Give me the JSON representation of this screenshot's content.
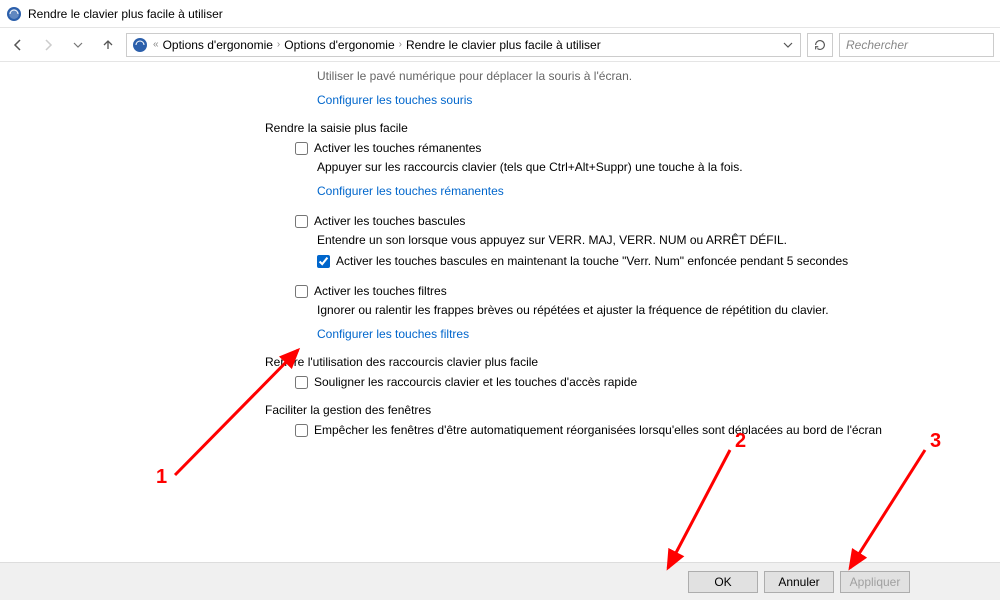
{
  "titlebar": {
    "title": "Rendre le clavier plus facile à utiliser"
  },
  "nav": {
    "breadcrumb": {
      "prefix": "«",
      "items": [
        "Options d'ergonomie",
        "Options d'ergonomie",
        "Rendre le clavier plus facile à utiliser"
      ]
    },
    "search_placeholder": "Rechercher"
  },
  "content": {
    "truncated_line": "Utiliser le pavé numérique pour déplacer la souris à l'écran.",
    "link_mouse": "Configurer les touches souris",
    "sec1": {
      "title": "Rendre la saisie plus facile",
      "sticky": {
        "label": "Activer les touches rémanentes",
        "desc": "Appuyer sur les raccourcis clavier (tels que Ctrl+Alt+Suppr) une touche à la fois.",
        "link": "Configurer les touches rémanentes"
      },
      "toggle": {
        "label": "Activer les touches bascules",
        "desc": "Entendre un son lorsque vous appuyez sur VERR. MAJ, VERR. NUM ou ARRÊT DÉFIL.",
        "sub_label": "Activer les touches bascules en maintenant la touche \"Verr. Num\" enfoncée pendant 5 secondes"
      },
      "filter": {
        "label": "Activer les touches filtres",
        "desc": "Ignorer ou ralentir les frappes brèves ou répétées et ajuster la fréquence de répétition du clavier.",
        "link": "Configurer les touches filtres"
      }
    },
    "sec2": {
      "title": "Rendre l'utilisation des raccourcis clavier plus facile",
      "underline": {
        "label": "Souligner les raccourcis clavier et les touches d'accès rapide"
      }
    },
    "sec3": {
      "title": "Faciliter la gestion des fenêtres",
      "prevent": {
        "label": "Empêcher les fenêtres d'être automatiquement réorganisées lorsqu'elles sont déplacées au bord de l'écran"
      }
    }
  },
  "footer": {
    "ok": "OK",
    "cancel": "Annuler",
    "apply": "Appliquer"
  },
  "annotations": {
    "n1": "1",
    "n2": "2",
    "n3": "3"
  }
}
